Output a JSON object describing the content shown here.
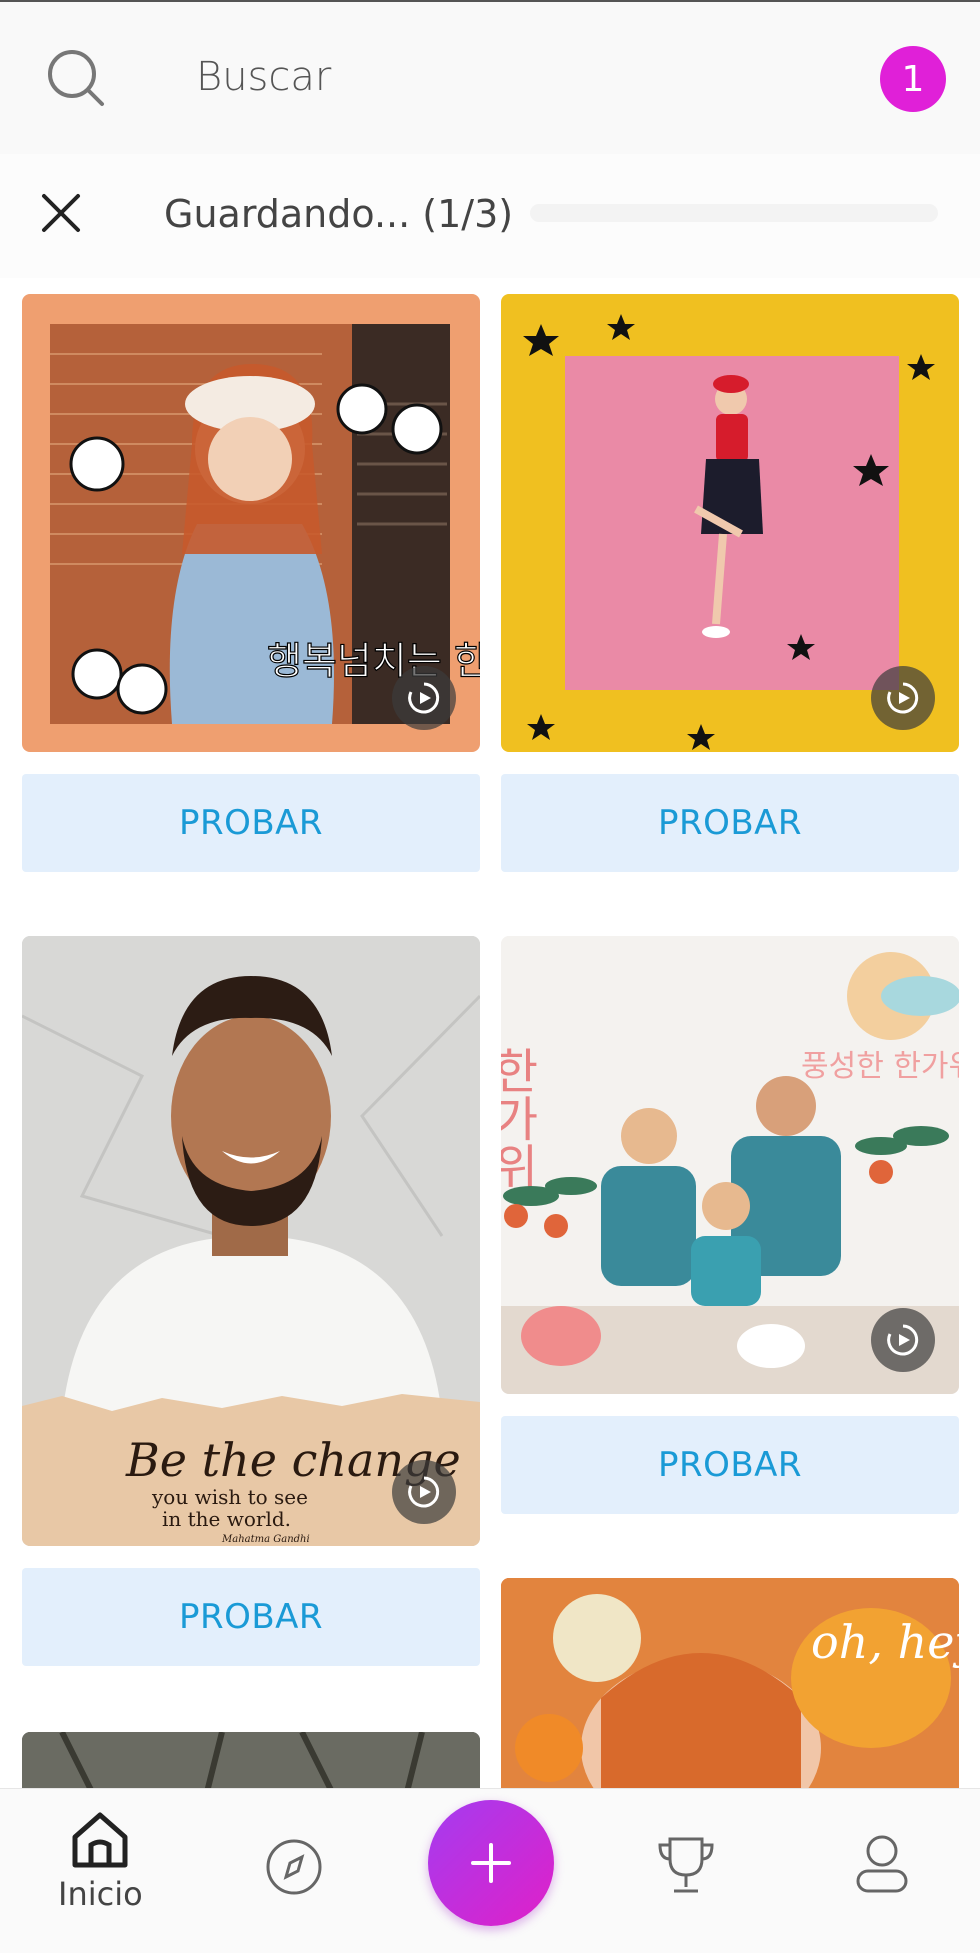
{
  "search": {
    "placeholder": "Buscar"
  },
  "notifications": {
    "count": "1"
  },
  "saving": {
    "text": "Guardando... (1/3)",
    "progress": 0.0
  },
  "cards": [
    {
      "button": "PROBAR",
      "overlay_text": "행복넘치는 한가위"
    },
    {
      "button": "PROBAR"
    },
    {
      "button": "PROBAR",
      "quote_main": "Be the change",
      "quote_sub1": "you wish to see",
      "quote_sub2": "in the world.",
      "quote_author": "Mahatma Gandhi"
    },
    {
      "button": "PROBAR",
      "overlay_text_left": "한가위",
      "overlay_text_right": "풍성한 한가위"
    },
    {
      "overlay_text": "oh, hey fall"
    }
  ],
  "nav": {
    "home_label": "Inicio",
    "items": [
      "home-icon",
      "compass-icon",
      "plus-icon",
      "trophy-icon",
      "profile-icon"
    ]
  },
  "colors": {
    "accent": "#e020d8",
    "button_bg": "#e3effc",
    "button_text": "#1a9ad6"
  }
}
